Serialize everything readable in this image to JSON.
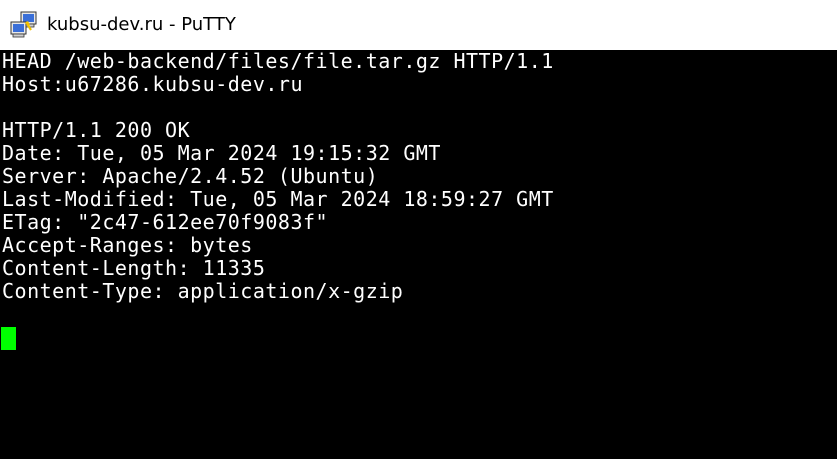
{
  "window": {
    "title": "kubsu-dev.ru - PuTTY",
    "icon": "putty-computers-icon"
  },
  "terminal": {
    "lines": [
      "HEAD /web-backend/files/file.tar.gz HTTP/1.1",
      "Host:u67286.kubsu-dev.ru",
      "",
      "HTTP/1.1 200 OK",
      "Date: Tue, 05 Mar 2024 19:15:32 GMT",
      "Server: Apache/2.4.52 (Ubuntu)",
      "Last-Modified: Tue, 05 Mar 2024 18:59:27 GMT",
      "ETag: \"2c47-612ee70f9083f\"",
      "Accept-Ranges: bytes",
      "Content-Length: 11335",
      "Content-Type: application/x-gzip"
    ],
    "cursor_color": "#00ff00",
    "text_color": "#ffffff",
    "background_color": "#000000"
  }
}
